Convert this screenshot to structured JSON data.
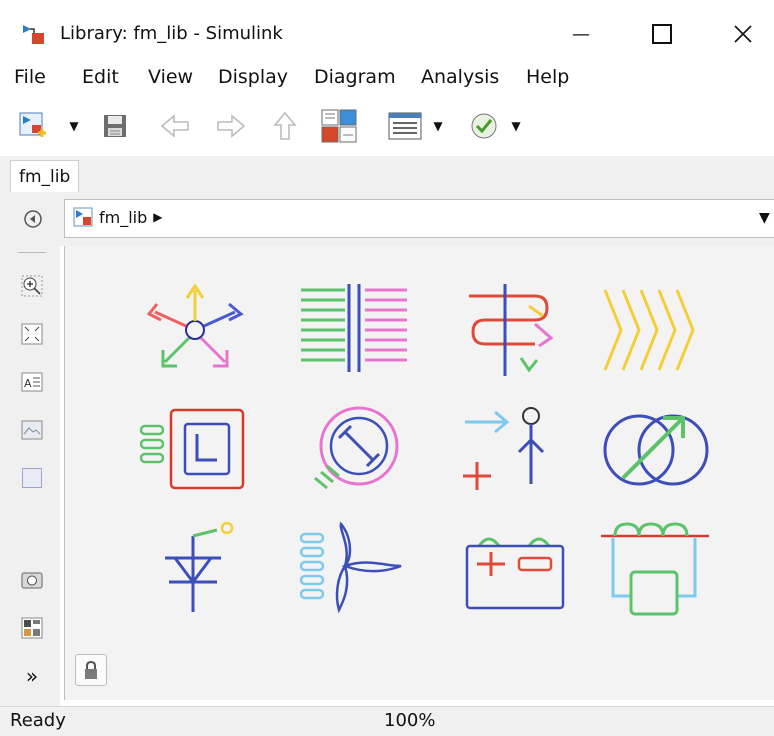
{
  "window": {
    "title": "Library: fm_lib - Simulink",
    "minimize_glyph": "—",
    "maximize_glyph": "☐",
    "close_glyph": "✕"
  },
  "menu": [
    "File",
    "Edit",
    "View",
    "Display",
    "Diagram",
    "Analysis",
    "Help"
  ],
  "tab": {
    "label": "fm_lib"
  },
  "address": {
    "crumb": "fm_lib",
    "arrow": "▶",
    "dropdown": "▼"
  },
  "lefttools": [
    "zoom-in-icon",
    "fit-view-icon",
    "text-annotation-icon",
    "image-annotation-icon",
    "area-icon",
    "screenshot-icon",
    "property-inspector-icon",
    "expand-icon"
  ],
  "expand_glyph": "»",
  "blocks": [
    "three-phase-machine-icon",
    "heat-exchanger-icon",
    "sensor-flow-icon",
    "heater-coil-icon",
    "l-inductor-icon",
    "rotor-disk-icon",
    "fluid-source-icon",
    "ring-motor-icon",
    "tower-icon",
    "wind-turbine-icon",
    "battery-icon",
    "transformer-load-icon"
  ],
  "status": {
    "left": "Ready",
    "zoom": "100%"
  },
  "colors": {
    "accent": "#1a6fb5",
    "red": "#d53a2a",
    "green": "#5cc36a",
    "purple": "#7b5cd6",
    "yellow": "#f2cf37",
    "pink": "#e874d0",
    "lightblue": "#7fc9ef",
    "blue": "#3c4fb8"
  }
}
